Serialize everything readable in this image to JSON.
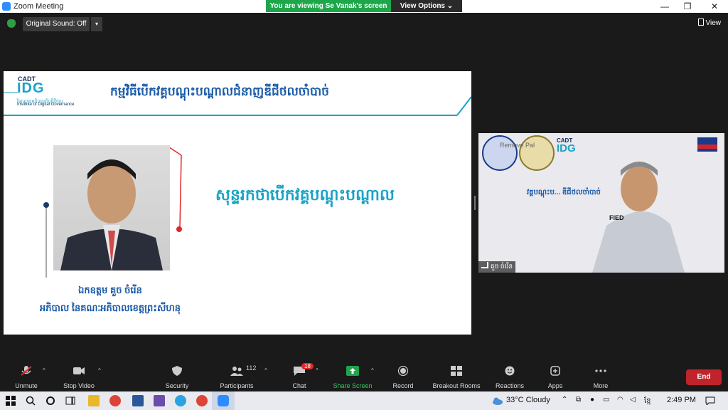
{
  "window": {
    "title": "Zoom Meeting",
    "minimize": "—",
    "restore": "❐",
    "close": "✕"
  },
  "banner": {
    "viewing": "You are viewing Se Vanak's screen",
    "view_options": "View Options ⌄"
  },
  "topbar": {
    "original_sound": "Original Sound: Off",
    "dropdown": "▾",
    "view": "View"
  },
  "slide": {
    "logo_cadt": "CADT",
    "logo_idg": "IDG",
    "logo_sub_kh": "វិទ្យាស្ថានអភិបាលកិច្ចឌីជីថល",
    "logo_sub_en": "Institute of Digital Governance",
    "heading": "កម្មវិធីបើកវគ្គបណ្តុះបណ្តាលជំនាញឌីជីថលចាំបាច់",
    "speech_title": "សុន្ទរកថាបើកវគ្គបណ្តុះបណ្តាល",
    "speaker_name": "ឯកឧត្តម គួច ចំរើន",
    "speaker_role": "អភិបាល នៃគណៈអភិបាលខេត្តព្រះសីហនុ"
  },
  "video": {
    "participant_name": "គួច ចំរើន",
    "bg_cadt": "CADT",
    "bg_idg": "IDG",
    "bg_text": "វគ្គបណ្តុះប... ឌីជីថលចាំបាច់",
    "bg_word": "FIED",
    "remove_pal": "Remove Pal"
  },
  "toolbar": {
    "unmute": "Unmute",
    "stop_video": "Stop Video",
    "security": "Security",
    "participants": "Participants",
    "participants_count": "112",
    "chat": "Chat",
    "chat_badge": "18",
    "share_screen": "Share Screen",
    "record": "Record",
    "breakout_rooms": "Breakout Rooms",
    "reactions": "Reactions",
    "apps": "Apps",
    "more": "More",
    "end": "End",
    "caret": "^"
  },
  "taskbar": {
    "weather": "33°C Cloudy",
    "ime": "ខ្មែ",
    "time": "2:49 PM"
  },
  "colors": {
    "share_green": "#1ea64a",
    "end_red": "#c0242a",
    "idg_blue": "#1aa3c6",
    "heading_blue": "#1a5aa8"
  }
}
